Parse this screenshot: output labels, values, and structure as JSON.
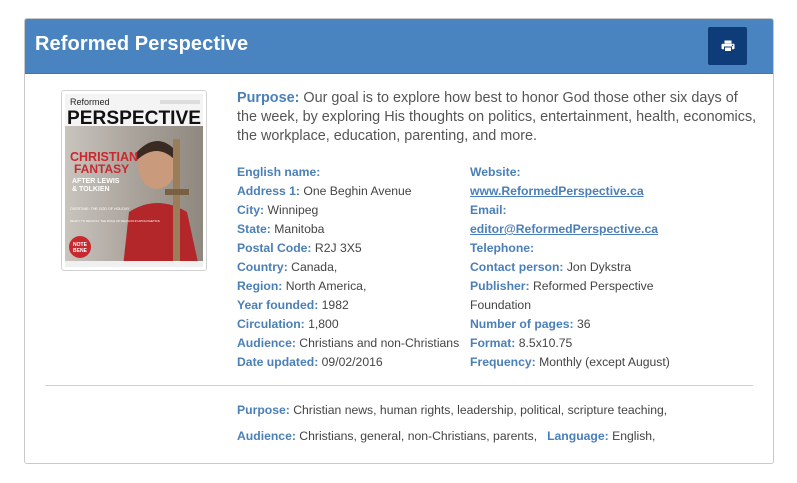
{
  "header": {
    "title": "Reformed Perspective",
    "print_icon": "printer-icon"
  },
  "cover": {
    "top_word": "Reformed",
    "masthead": "PERSPECTIVE",
    "headline_1": "CHRISTIAN",
    "headline_2": "FANTASY",
    "sub_1": "AFTER LEWIS",
    "sub_2": "& TOLKIEN",
    "teaser_1": "OVERTIME: THE GOD OF HOLIDAY",
    "teaser_2": "READY TO REASON: THE ROLE OF REASON IN APOLOGETICS",
    "badge_1": "NOTE",
    "badge_2": "BENE"
  },
  "purpose_lead": {
    "label": "Purpose:",
    "text": " Our goal is to explore how best to honor God those other six days of the week, by exploring His thoughts on politics, entertainment, health, economics, the workplace, education, parenting, and more."
  },
  "left_fields": [
    {
      "label": "English name:",
      "value": ""
    },
    {
      "label": "Address 1:",
      "value": " One Beghin Avenue"
    },
    {
      "label": "City:",
      "value": " Winnipeg"
    },
    {
      "label": "State:",
      "value": " Manitoba"
    },
    {
      "label": "Postal Code:",
      "value": " R2J 3X5"
    },
    {
      "label": "Country:",
      "value": " Canada,"
    },
    {
      "label": "Region:",
      "value": " North America,"
    },
    {
      "label": "Year founded:",
      "value": " 1982"
    },
    {
      "label": "Circulation:",
      "value": " 1,800"
    },
    {
      "label": "Audience:",
      "value": " Christians and non-Christians"
    },
    {
      "label": "Date updated:",
      "value": " 09/02/2016"
    }
  ],
  "right_fields": {
    "website_label": "Website:",
    "website": "www.ReformedPerspective.ca",
    "email_label": "Email:",
    "email": "editor@ReformedPerspective.ca",
    "telephone_label": "Telephone:",
    "contact_label": "Contact person:",
    "contact": " Jon Dykstra",
    "publisher_label": "Publisher:",
    "publisher_line1": " Reformed Perspective",
    "publisher_line2": "Foundation",
    "pages_label": "Number of pages:",
    "pages": " 36",
    "format_label": "Format:",
    "format": " 8.5x10.75",
    "frequency_label": "Frequency:",
    "frequency": " Monthly (except August)"
  },
  "footer": {
    "purpose_label": "Purpose:",
    "purpose_value": " Christian news, human rights, leadership, political, scripture teaching,",
    "audience_label": "Audience:",
    "audience_value": " Christians, general, non-Christians, parents,",
    "language_label": "Language:",
    "language_value": " English,"
  }
}
